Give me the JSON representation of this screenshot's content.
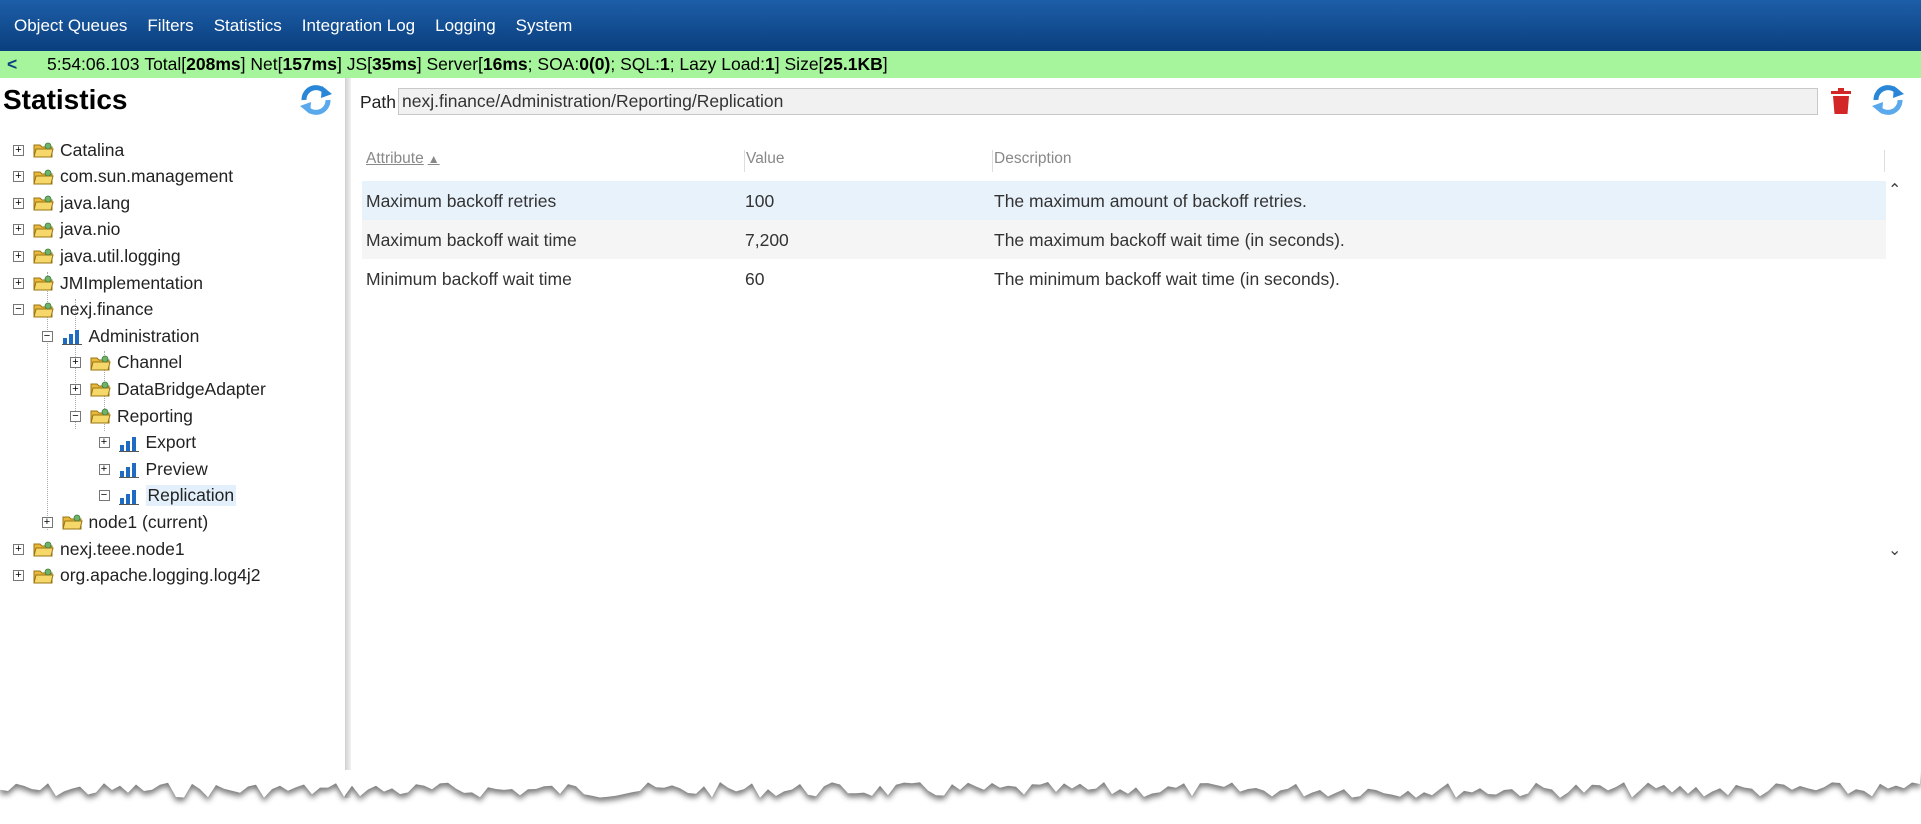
{
  "nav": [
    "Object Queues",
    "Filters",
    "Statistics",
    "Integration Log",
    "Logging",
    "System"
  ],
  "status": {
    "back": "<",
    "time": "5:54:06.103",
    "total_label": "Total[",
    "total": "208ms",
    "net_label": "] Net[",
    "net": "157ms",
    "js_label": "] JS[",
    "js": "35ms",
    "server_label": "] Server[",
    "server": "16ms",
    "soa_label": "; SOA: ",
    "soa": "0(0)",
    "sql_label": "; SQL: ",
    "sql": "1",
    "lazy_label": "; Lazy Load: ",
    "lazy": "1",
    "size_label": "] Size[",
    "size": "25.1KB",
    "end": "]"
  },
  "left": {
    "title": "Statistics",
    "tree": [
      {
        "label": "Catalina",
        "icon": "folder",
        "level": 0,
        "state": "collapsed"
      },
      {
        "label": "com.sun.management",
        "icon": "folder",
        "level": 0,
        "state": "collapsed"
      },
      {
        "label": "java.lang",
        "icon": "folder",
        "level": 0,
        "state": "collapsed"
      },
      {
        "label": "java.nio",
        "icon": "folder",
        "level": 0,
        "state": "collapsed"
      },
      {
        "label": "java.util.logging",
        "icon": "folder",
        "level": 0,
        "state": "collapsed"
      },
      {
        "label": "JMImplementation",
        "icon": "folder",
        "level": 0,
        "state": "collapsed"
      },
      {
        "label": "nexj.finance",
        "icon": "folder",
        "level": 0,
        "state": "expanded"
      },
      {
        "label": "Administration",
        "icon": "chart",
        "level": 1,
        "state": "expanded"
      },
      {
        "label": "Channel",
        "icon": "folder",
        "level": 2,
        "state": "collapsed"
      },
      {
        "label": "DataBridgeAdapter",
        "icon": "folder",
        "level": 2,
        "state": "collapsed"
      },
      {
        "label": "Reporting",
        "icon": "folder",
        "level": 2,
        "state": "expanded"
      },
      {
        "label": "Export",
        "icon": "chart",
        "level": 3,
        "state": "collapsed"
      },
      {
        "label": "Preview",
        "icon": "chart",
        "level": 3,
        "state": "collapsed"
      },
      {
        "label": "Replication",
        "icon": "chart",
        "level": 3,
        "state": "expanded",
        "selected": true
      },
      {
        "label": "node1 (current)",
        "icon": "folder",
        "level": 1,
        "state": "collapsed"
      },
      {
        "label": "nexj.teee.node1",
        "icon": "folder",
        "level": 0,
        "state": "collapsed"
      },
      {
        "label": "org.apache.logging.log4j2",
        "icon": "folder",
        "level": 0,
        "state": "collapsed"
      }
    ]
  },
  "right": {
    "path_label": "Path",
    "path_value": "nexj.finance/Administration/Reporting/Replication",
    "columns": [
      "Attribute",
      "Value",
      "Description"
    ],
    "rows": [
      {
        "attribute": "Maximum backoff retries",
        "value": "100",
        "description": "The maximum amount of backoff retries."
      },
      {
        "attribute": "Maximum backoff wait time",
        "value": "7,200",
        "description": "The maximum backoff wait time (in seconds)."
      },
      {
        "attribute": "Minimum backoff wait time",
        "value": "60",
        "description": "The minimum backoff wait time (in seconds)."
      }
    ]
  },
  "colors": {
    "nav_bg": "#0a3f7e",
    "status_bg": "#a6f59c",
    "row_hover": "#e8f2fb",
    "row_alt": "#f5f5f5",
    "trash": "#d32626",
    "refresh": "#2a86d6"
  }
}
